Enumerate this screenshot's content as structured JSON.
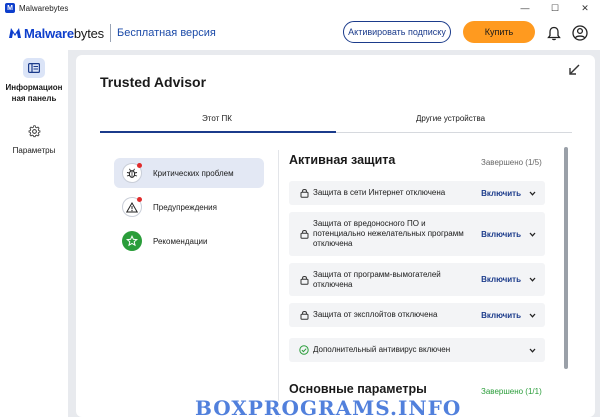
{
  "window": {
    "title": "Malwarebytes",
    "controls": {
      "minimize": "—",
      "maximize": "☐",
      "close": "✕"
    }
  },
  "header": {
    "brand_part1": "Malware",
    "brand_part2": "bytes",
    "edition": "Бесплатная версия",
    "activate_label": "Активировать подписку",
    "buy_label": "Купить",
    "icons": [
      "bell-icon",
      "account-icon"
    ]
  },
  "sidebar": {
    "items": [
      {
        "label": "Информацион\nная панель",
        "icon": "dashboard-icon",
        "active": true
      },
      {
        "label": "Параметры",
        "icon": "gear-icon",
        "active": false
      }
    ]
  },
  "card": {
    "title": "Trusted Advisor",
    "tabs": [
      {
        "label": "Этот ПК",
        "active": true
      },
      {
        "label": "Другие устройства",
        "active": false
      }
    ],
    "categories": [
      {
        "label": "Критических проблем",
        "icon": "bug-icon",
        "active": true
      },
      {
        "label": "Предупреждения",
        "icon": "warning-icon",
        "active": false
      },
      {
        "label": "Рекомендации",
        "icon": "star-icon",
        "active": false
      }
    ],
    "active_protection": {
      "title": "Активная защита",
      "status": "Завершено (1/5)",
      "rows": [
        {
          "text": "Защита в сети Интернет отключена",
          "action": "Включить",
          "icon": "lock-icon"
        },
        {
          "text": "Защита от вредоносного ПО и потенциально нежелательных программ отключена",
          "action": "Включить",
          "icon": "lock-icon"
        },
        {
          "text": "Защита от программ-вымогателей отключена",
          "action": "Включить",
          "icon": "lock-icon"
        },
        {
          "text": "Защита от эксплойтов отключена",
          "action": "Включить",
          "icon": "lock-icon"
        },
        {
          "text": "Дополнительный антивирус включен",
          "action": "",
          "icon": "check-circle-icon"
        }
      ]
    },
    "basic_params": {
      "title": "Основные параметры",
      "status": "Завершено (1/1)"
    }
  },
  "watermark": "BOXPROGRAMS.INFO",
  "colors": {
    "accent": "#1b3b8b",
    "buy": "#ff9a1f",
    "critical": "#e02b2b",
    "success": "#2a9d3a"
  }
}
